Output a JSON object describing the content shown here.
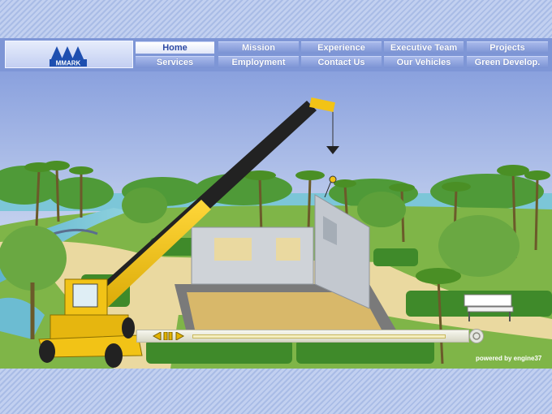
{
  "logo": {
    "text": "MMARK"
  },
  "nav": {
    "row1": [
      {
        "label": "Home",
        "active": true
      },
      {
        "label": "Mission"
      },
      {
        "label": "Experience"
      },
      {
        "label": "Executive Team"
      },
      {
        "label": "Projects"
      }
    ],
    "row2": [
      {
        "label": "Services"
      },
      {
        "label": "Employment"
      },
      {
        "label": "Contact Us"
      },
      {
        "label": "Our Vehicles"
      },
      {
        "label": "Green Develop."
      }
    ]
  },
  "player": {
    "powered_by": "powered by engine37"
  },
  "colors": {
    "sky_top": "#8aa1de",
    "sky_bottom": "#e8eef6",
    "crane": "#f2c316",
    "grass": "#7fb548",
    "path": "#ead9a0",
    "nav_bg": "#7e96d6"
  }
}
